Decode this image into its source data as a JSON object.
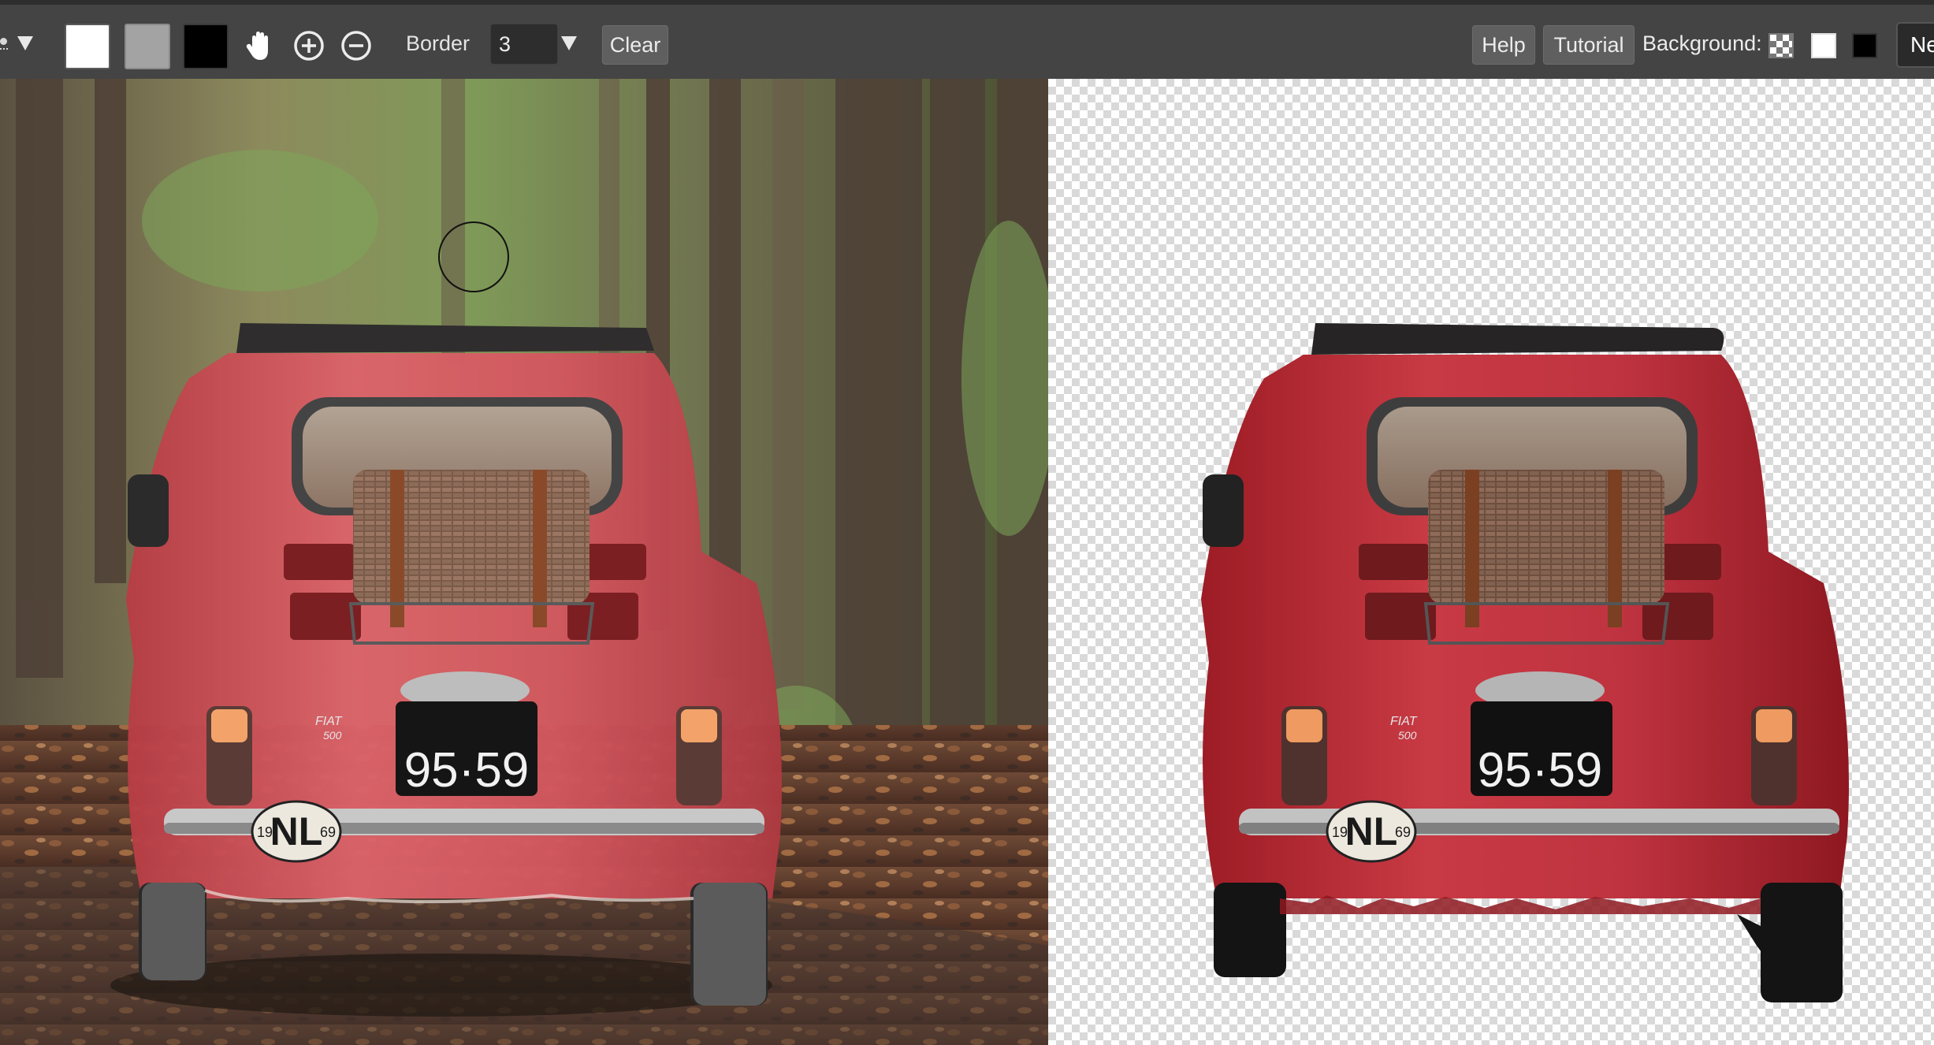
{
  "toolbar": {
    "tools": [
      {
        "name": "brush-tool",
        "icon": "brush-icon"
      },
      {
        "name": "foreground-swatch",
        "color": "#ffffff"
      },
      {
        "name": "mid-swatch",
        "color": "#a3a3a3"
      },
      {
        "name": "background-swatch",
        "color": "#000000"
      },
      {
        "name": "pan-tool",
        "icon": "hand-icon"
      },
      {
        "name": "zoom-in",
        "icon": "plus-circle-icon"
      },
      {
        "name": "zoom-out",
        "icon": "minus-circle-icon"
      }
    ],
    "border_label": "Border",
    "border_value": "3",
    "clear_label": "Clear",
    "help_label": "Help",
    "tutorial_label": "Tutorial",
    "background_label": "Background:",
    "background_options": [
      "transparent",
      "white",
      "black"
    ],
    "next_label": "Ne"
  },
  "plate": {
    "number": "95·59",
    "country": "NL",
    "year_left": "19",
    "year_right": "69",
    "badge_line1": "FIAT",
    "badge_line2": "500"
  },
  "colors": {
    "toolbar": "#444444",
    "car_red": "#c62a33",
    "checker": "#d9d9d9"
  }
}
